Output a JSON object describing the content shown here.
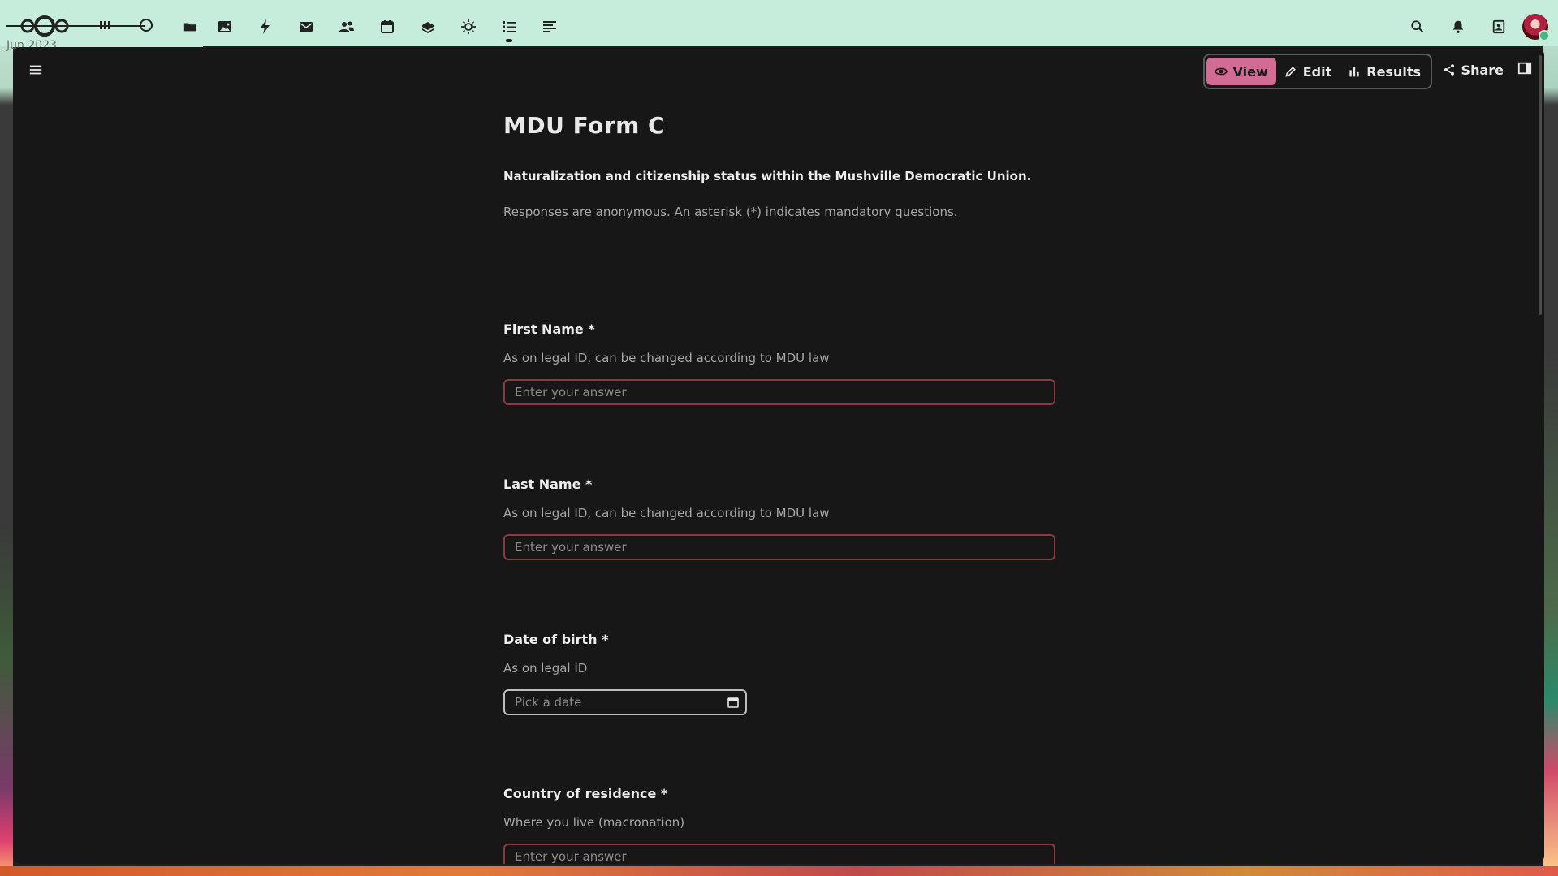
{
  "header": {
    "date_text": "Jun 2023",
    "apps": [
      {
        "name": "photos-icon"
      },
      {
        "name": "activity-icon"
      },
      {
        "name": "mail-icon"
      },
      {
        "name": "contacts-icon"
      },
      {
        "name": "calendar-icon"
      },
      {
        "name": "deck-icon"
      },
      {
        "name": "weather-icon"
      },
      {
        "name": "forms-icon"
      },
      {
        "name": "notes-icon"
      }
    ],
    "accent_color": "#c6ecdb"
  },
  "toolbar": {
    "view_label": "View",
    "edit_label": "Edit",
    "results_label": "Results",
    "share_label": "Share",
    "active_color": "#d36c95"
  },
  "form": {
    "title": "MDU Form C",
    "description": "Naturalization and citizenship status within the Mushville Democratic Union.",
    "note": "Responses are anonymous. An asterisk (*) indicates mandatory questions.",
    "questions": [
      {
        "label": "First Name *",
        "help": "As on legal ID, can be changed according to MDU law",
        "placeholder": "Enter your answer"
      },
      {
        "label": "Last Name *",
        "help": "As on legal ID, can be changed according to MDU law",
        "placeholder": "Enter your answer"
      },
      {
        "label": "Date of birth *",
        "help": "As on legal ID",
        "placeholder": "Pick a date"
      },
      {
        "label": "Country of residence *",
        "help": "Where you live (macronation)",
        "placeholder": "Enter your answer"
      }
    ]
  }
}
